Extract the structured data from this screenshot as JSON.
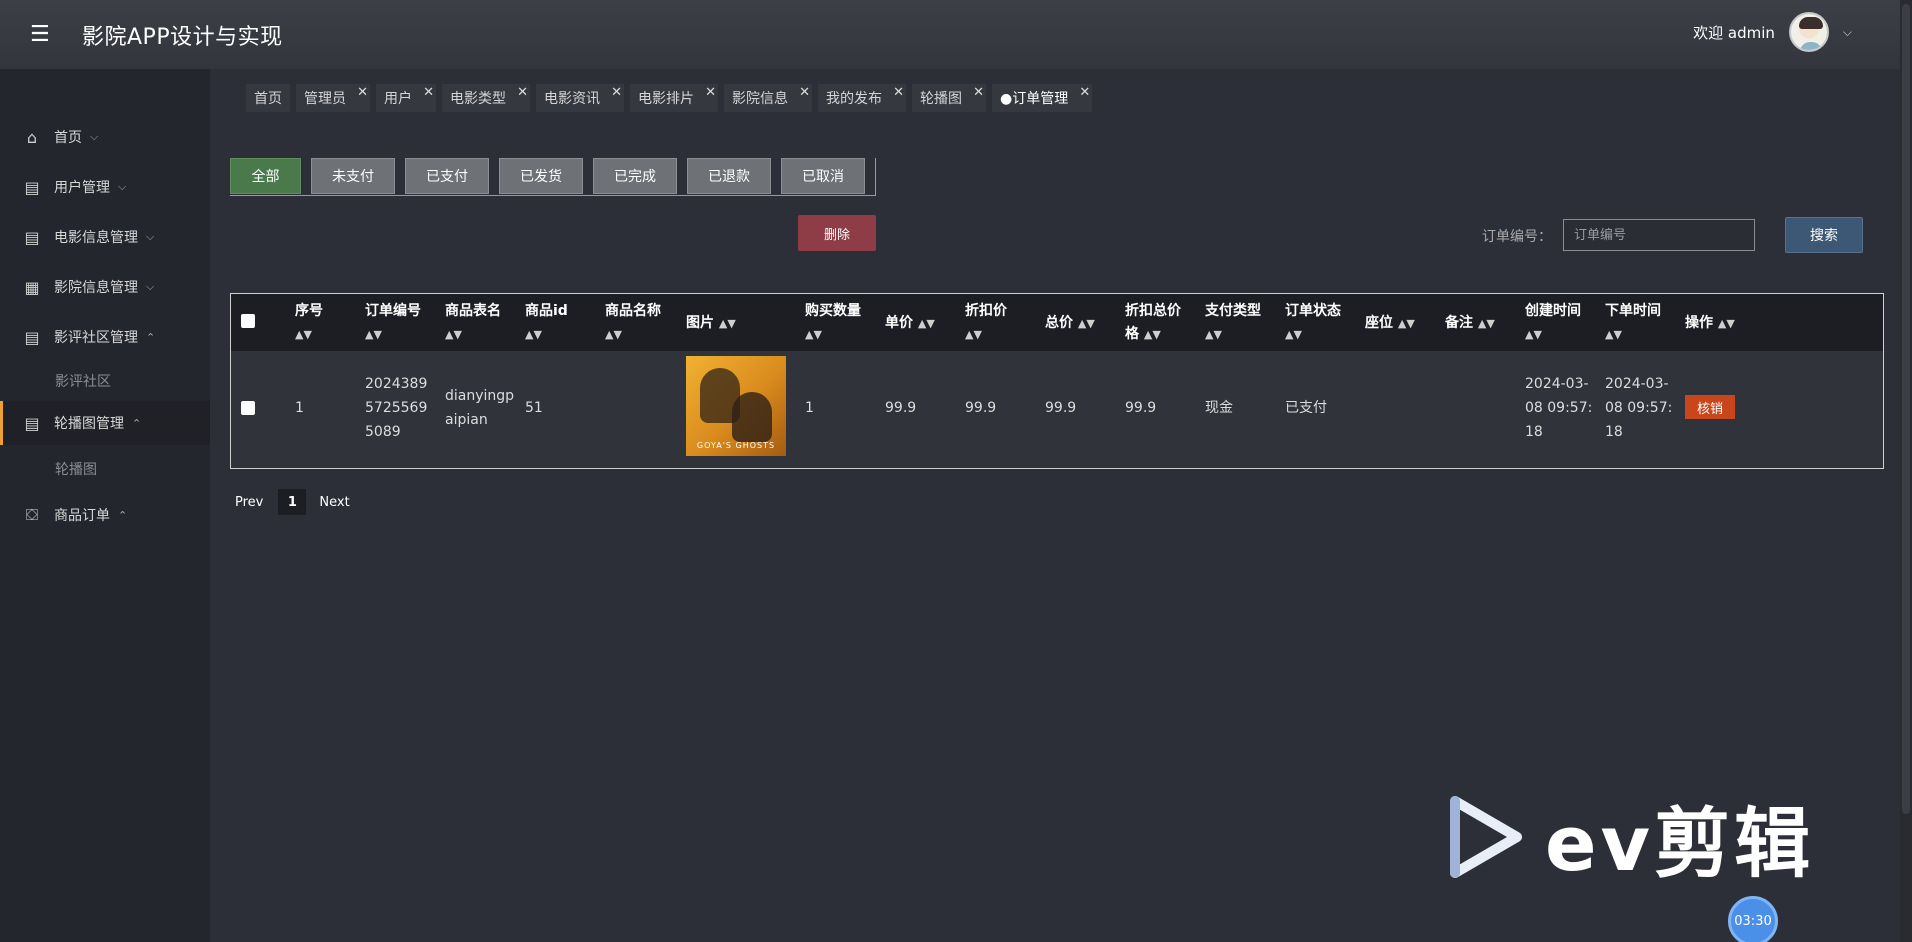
{
  "header": {
    "menu_icon": "hamburger-icon",
    "title": "影院APP设计与实现",
    "welcome": "欢迎 admin"
  },
  "sidebar": {
    "items": [
      {
        "label": "首页",
        "icon": "home-icon",
        "chevron": "⌵"
      },
      {
        "label": "用户管理",
        "icon": "table-icon",
        "chevron": "⌵"
      },
      {
        "label": "电影信息管理",
        "icon": "table-icon",
        "chevron": "⌵"
      },
      {
        "label": "影院信息管理",
        "icon": "grid-icon",
        "chevron": "⌵"
      },
      {
        "label": "影评社区管理",
        "icon": "table-icon",
        "chevron": "⌃"
      },
      {
        "label": "轮播图管理",
        "icon": "table-icon",
        "chevron": "⌃"
      },
      {
        "label": "商品订单",
        "icon": "briefcase-icon",
        "chevron": "⌃"
      }
    ],
    "sub_items": [
      "影评社区",
      "轮播图"
    ]
  },
  "tabs": [
    {
      "label": "首页",
      "closable": false
    },
    {
      "label": "管理员",
      "closable": true
    },
    {
      "label": "用户",
      "closable": true
    },
    {
      "label": "电影类型",
      "closable": true
    },
    {
      "label": "电影资讯",
      "closable": true
    },
    {
      "label": "电影排片",
      "closable": true
    },
    {
      "label": "影院信息",
      "closable": true
    },
    {
      "label": "我的发布",
      "closable": true
    },
    {
      "label": "轮播图",
      "closable": true
    },
    {
      "label": "●订单管理",
      "closable": true,
      "active": true
    }
  ],
  "status_filters": [
    "全部",
    "未支付",
    "已支付",
    "已发货",
    "已完成",
    "已退款",
    "已取消"
  ],
  "active_filter": "全部",
  "actions": {
    "delete_label": "删除",
    "search_label": "订单编号：",
    "search_placeholder": "订单编号",
    "search_button": "搜索"
  },
  "table": {
    "headers": [
      "序号",
      "订单编号",
      "商品表名",
      "商品id",
      "商品名称",
      "图片",
      "购买数量",
      "单价",
      "折扣价",
      "总价",
      "折扣总价格",
      "支付类型",
      "订单状态",
      "座位",
      "备注",
      "创建时间",
      "下单时间",
      "操作"
    ],
    "rows": [
      {
        "index": "1",
        "order_no": "20243895725569 5089",
        "order_no_lines": [
          "2024389",
          "5725569",
          "5089"
        ],
        "table_name_lines": [
          "dianyingp",
          "aipian"
        ],
        "goods_id": "51",
        "goods_name": "",
        "poster_title": "GOYA'S GHOSTS",
        "quantity": "1",
        "price": "99.9",
        "discount_price": "99.9",
        "total": "99.9",
        "discount_total": "99.9",
        "pay_type": "现金",
        "status": "已支付",
        "seat": "",
        "remark": "",
        "created_lines": [
          "2024-03-",
          "08 09:57:",
          "18"
        ],
        "ordered_lines": [
          "2024-03-",
          "08 09:57:",
          "18"
        ],
        "action": "核销"
      }
    ]
  },
  "pagination": {
    "prev": "Prev",
    "current": "1",
    "next": "Next"
  },
  "watermark": {
    "text": "ev剪辑",
    "icon": "play-icon"
  },
  "timer": "03:30",
  "colors": {
    "accent_active": "#4a7a4c",
    "delete": "#8e3d47",
    "search": "#3c5874",
    "cancel": "#c8461c",
    "sidebar_active_border": "#f0a030"
  }
}
